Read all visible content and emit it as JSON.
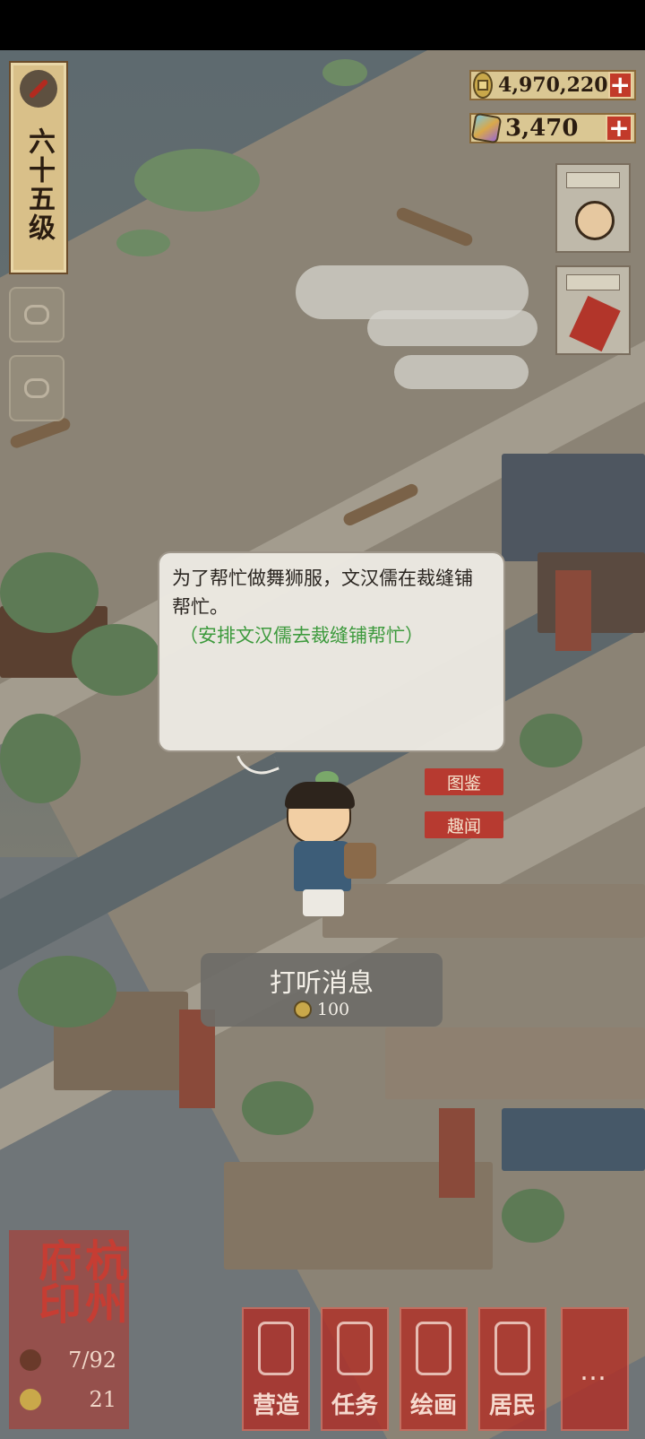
{
  "level": {
    "label": "六十五级"
  },
  "currencies": [
    {
      "icon": "copper-coin-icon",
      "value": "4,970,220",
      "plus": "+"
    },
    {
      "icon": "gem-icon",
      "value": "3,470",
      "plus": "+"
    }
  ],
  "dialog": {
    "text": "为了帮忙做舞狮服，文汉儒在裁缝铺帮忙。",
    "hint": "（安排文汉儒去裁缝铺帮忙）"
  },
  "tags": {
    "catalog": "图鉴",
    "anecdote": "趣闻"
  },
  "action": {
    "title": "打听消息",
    "cost": "100"
  },
  "seal": {
    "title": "杭州府印",
    "stat1": "7/92",
    "stat2": "21"
  },
  "menu": [
    {
      "icon": "build-icon",
      "label": "营造"
    },
    {
      "icon": "task-icon",
      "label": "任务"
    },
    {
      "icon": "painting-icon",
      "label": "绘画"
    },
    {
      "icon": "residents-icon",
      "label": "居民"
    },
    {
      "icon": "more-icon",
      "label": "…"
    }
  ],
  "colors": {
    "accent_red": "#b73a30",
    "hint_green": "#3d9a3d",
    "badge_gold": "#d9c089"
  }
}
